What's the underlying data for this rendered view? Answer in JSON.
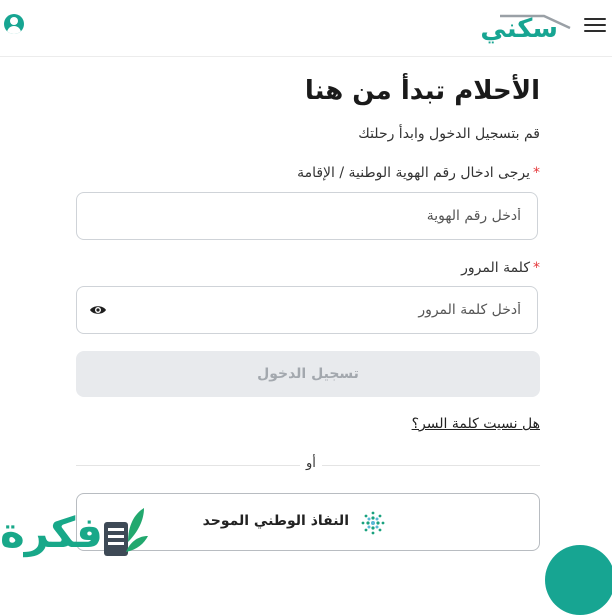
{
  "header": {
    "logo_text": "سكني",
    "menu_icon": "hamburger-icon",
    "user_icon": "user-icon"
  },
  "form": {
    "title": "الأحلام تبدأ من هنا",
    "subtitle": "قم بتسجيل الدخول وابدأ رحلتك",
    "id_label": "يرجى ادخال رقم الهوية الوطنية / الإقامة",
    "required_mark": "*",
    "id_placeholder": "أدخل رقم الهوية",
    "password_label": "كلمة المرور",
    "password_placeholder": "أدخل كلمة المرور",
    "login_button": "تسجيل الدخول",
    "forgot_link": "هل نسيت كلمة السر؟",
    "or_text": "أو",
    "nafath_button": "النفاذ الوطني الموحد"
  },
  "watermark": {
    "text": "فكرة"
  },
  "colors": {
    "brand": "#17a592",
    "required": "#e5383b",
    "disabled_button_bg": "#e8eaed",
    "disabled_button_text": "#a3a8ae"
  }
}
